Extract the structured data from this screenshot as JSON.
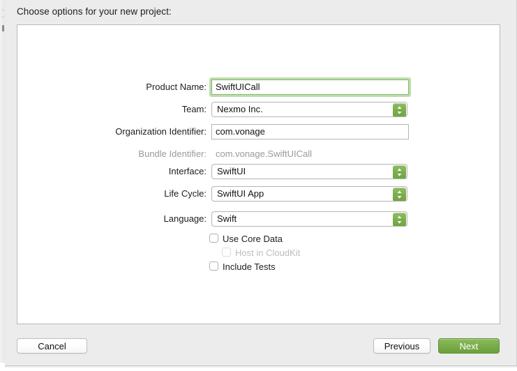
{
  "dialog": {
    "title": "Choose options for your new project:"
  },
  "form": {
    "rows": [
      {
        "label": "Product Name:",
        "value": "SwiftUICall",
        "type": "text",
        "focused": true
      },
      {
        "label": "Team:",
        "value": "Nexmo Inc.",
        "type": "popup",
        "focused": false
      },
      {
        "label": "Organization Identifier:",
        "value": "com.vonage",
        "type": "text",
        "focused": false
      },
      {
        "label": "Bundle Identifier:",
        "value": "com.vonage.SwiftUICall",
        "type": "static",
        "focused": false
      },
      {
        "label": "Interface:",
        "value": "SwiftUI",
        "type": "popup",
        "focused": false
      },
      {
        "label": "Life Cycle:",
        "value": "SwiftUI App",
        "type": "popup",
        "focused": false
      },
      {
        "label": "Language:",
        "value": "Swift",
        "type": "popup",
        "focused": false
      }
    ],
    "checkboxes": [
      {
        "label": "Use Core Data",
        "checked": false,
        "disabled": false,
        "indented": false
      },
      {
        "label": "Host in CloudKit",
        "checked": false,
        "disabled": true,
        "indented": true
      },
      {
        "label": "Include Tests",
        "checked": false,
        "disabled": false,
        "indented": false
      }
    ]
  },
  "footer": {
    "cancel_label": "Cancel",
    "previous_label": "Previous",
    "next_label": "Next"
  },
  "colors": {
    "accent_green": "#7bad4c",
    "accent_green_dark": "#6ba03c",
    "focus_ring": "#8abe6c",
    "dialog_bg": "#ececec",
    "panel_bg": "#ffffff",
    "text": "#1d1d1d",
    "text_dim": "#9a9a9a"
  }
}
